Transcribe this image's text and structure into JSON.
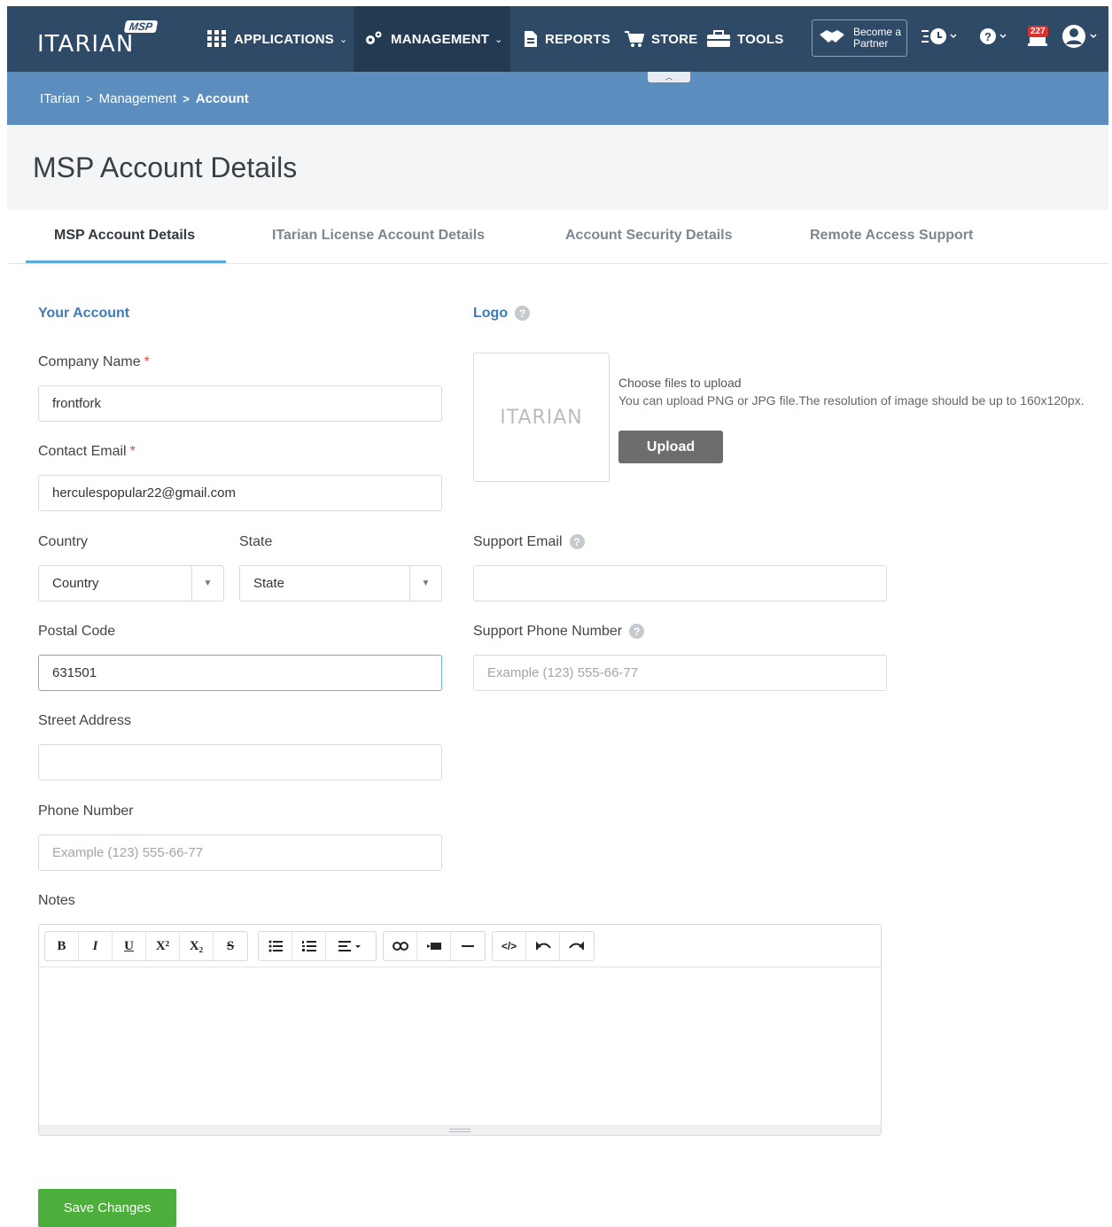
{
  "brand": {
    "wordmark": "ITARIAN",
    "badge": "MSP"
  },
  "nav": {
    "applications": "APPLICATIONS",
    "management": "MANAGEMENT",
    "reports": "REPORTS",
    "store": "STORE",
    "tools": "TOOLS",
    "partner_line1": "Become a",
    "partner_line2": "Partner",
    "notification_count": "227"
  },
  "breadcrumb": {
    "root": "ITarian",
    "parent": "Management",
    "current": "Account"
  },
  "page": {
    "title": "MSP Account Details"
  },
  "tabs": [
    {
      "label": "MSP Account Details"
    },
    {
      "label": "ITarian License Account Details"
    },
    {
      "label": "Account Security Details"
    },
    {
      "label": "Remote Access Support"
    }
  ],
  "form": {
    "section_title": "Your Account",
    "company_name": {
      "label": "Company Name",
      "value": "frontfork"
    },
    "contact_email": {
      "label": "Contact Email",
      "value": "herculespopular22@gmail.com"
    },
    "country": {
      "label": "Country",
      "value": "Country"
    },
    "state": {
      "label": "State",
      "value": "State"
    },
    "postal_code": {
      "label": "Postal Code",
      "value": "631501"
    },
    "street_address": {
      "label": "Street Address",
      "value": ""
    },
    "phone_number": {
      "label": "Phone Number",
      "placeholder": "Example (123) 555-66-77"
    },
    "notes": {
      "label": "Notes"
    },
    "required_mark": "*"
  },
  "logo": {
    "title": "Logo",
    "preview_text": "ITARIAN",
    "choose_text": "Choose files to upload",
    "description": "You can upload PNG or JPG file.The resolution of image should be up to 160x120px.",
    "upload_label": "Upload"
  },
  "support": {
    "email": {
      "label": "Support Email",
      "value": ""
    },
    "phone": {
      "label": "Support Phone Number",
      "placeholder": "Example (123) 555-66-77"
    }
  },
  "editor": {
    "bold": "B",
    "italic": "I",
    "underline": "U",
    "superscript": "X²",
    "subscript": "X₂",
    "strike": "S",
    "code": "</>"
  },
  "actions": {
    "save_label": "Save Changes"
  },
  "colors": {
    "nav_bg": "#2e4a66",
    "breadcrumb_bg": "#5b8dbf",
    "accent": "#3e7cb8",
    "save": "#4cae3b",
    "tab_underline": "#5aa9dd"
  }
}
